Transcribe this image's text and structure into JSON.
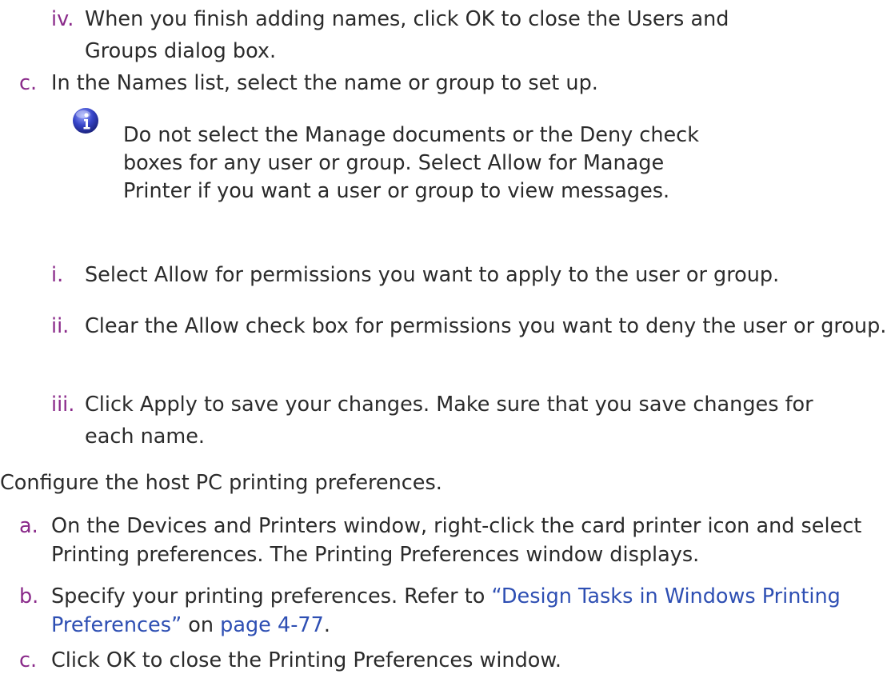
{
  "steps": {
    "step_b_iv": {
      "marker": "iv.",
      "text": "When you finish adding names, click OK to close the Users and Groups dialog box."
    },
    "step_c": {
      "marker": "c.",
      "text": "In the Names list, select the name or group to set up."
    },
    "note": {
      "icon": "info-icon",
      "text": "Do not select the Manage documents or the Deny check boxes for any user or group. Select Allow for Manage Printer if you want a user or group to view messages."
    },
    "step_c_i": {
      "marker": "i.",
      "text": "Select Allow for permissions you want to apply to the user or group."
    },
    "step_c_ii": {
      "marker": "ii.",
      "text": "Clear the Allow check box for permissions you want to deny the user or group."
    },
    "step_c_iii": {
      "marker": "iii.",
      "text": "Click Apply to save your changes. Make sure that you save changes for each name."
    },
    "configure": {
      "text": "Configure the host PC printing preferences."
    },
    "step2_a": {
      "marker": "a.",
      "text": "On the Devices and Printers window, right-click the card printer icon and select Printing preferences. The Printing Preferences window displays."
    },
    "step2_b": {
      "marker": "b.",
      "text_before": "Specify your printing preferences. Refer to ",
      "link1": "“Design Tasks in Windows Printing Preferences”",
      "text_middle": " on ",
      "link2": "page 4-77",
      "text_after": "."
    },
    "step2_c": {
      "marker": "c.",
      "text": "Click OK to close the Printing Preferences window."
    }
  },
  "colors": {
    "marker": "#8a2a8a",
    "link": "#2e4fb3",
    "text": "#2b2b2b"
  }
}
